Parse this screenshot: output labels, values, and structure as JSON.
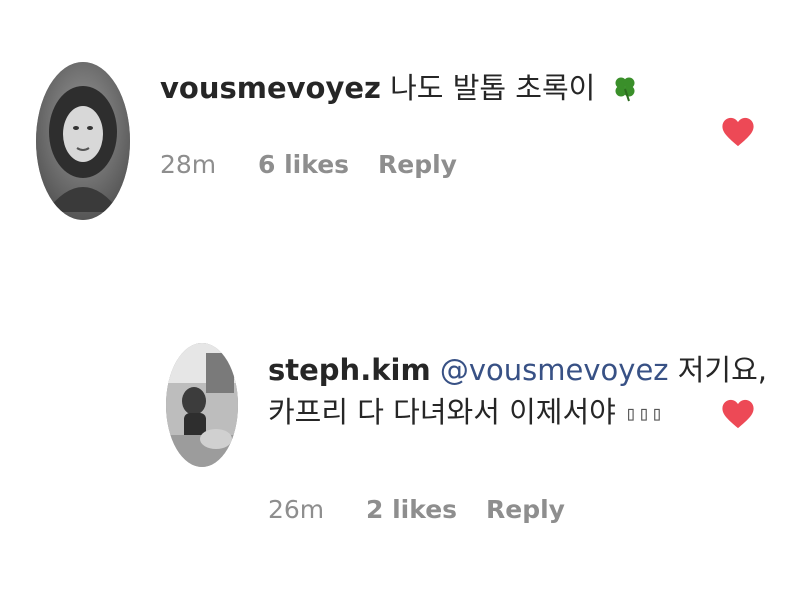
{
  "comments": [
    {
      "username": "vousmevoyez",
      "text": "나도 발톱 초록이",
      "emoji": "four-leaf-clover",
      "time": "28m",
      "likes": "6 likes",
      "reply": "Reply",
      "liked": true
    },
    {
      "username": "steph.kim",
      "mention": "@vousmevoyez",
      "text_line1": "저기요,",
      "text_line2": "카프리 다 다녀와서 이제서야",
      "text_tail": "▯▯▯",
      "time": "26m",
      "likes": "2 likes",
      "reply": "Reply",
      "liked": true
    }
  ],
  "colors": {
    "heart": "#ed4956",
    "meta": "#8e8e8e",
    "mention": "#385185",
    "text": "#262626"
  }
}
